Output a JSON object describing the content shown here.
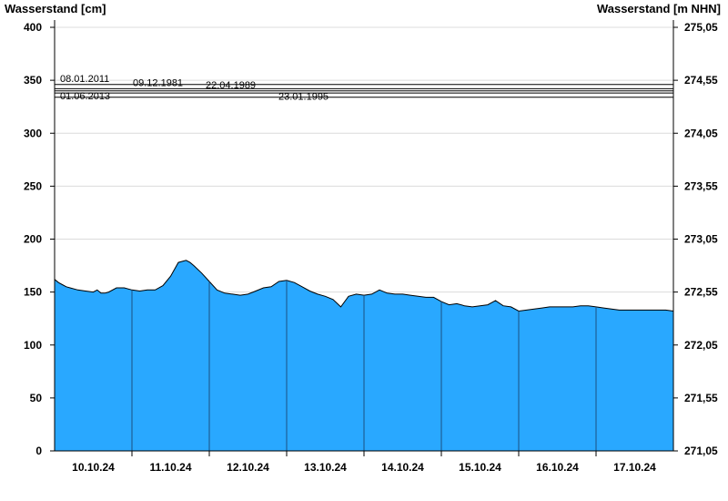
{
  "chart_data": {
    "type": "area",
    "ylabel_left": "Wasserstand [cm]",
    "ylabel_right": "Wasserstand [m NHN]",
    "ylim": [
      0,
      400
    ],
    "y_ticks_left": [
      "0",
      "50",
      "100",
      "150",
      "200",
      "250",
      "300",
      "350",
      "400"
    ],
    "y_ticks_right": [
      "271,05",
      "271,55",
      "272,05",
      "272,55",
      "273,05",
      "273,55",
      "274,05",
      "274,55",
      "275,05"
    ],
    "x_tick_labels": [
      "10.10.24",
      "11.10.24",
      "12.10.24",
      "13.10.24",
      "14.10.24",
      "15.10.24",
      "16.10.24",
      "17.10.24"
    ],
    "grid": true,
    "fill_color": "#29a8ff",
    "line_color": "#000000",
    "x_unit": "days since 09.10.24 12:00",
    "series": [
      {
        "x": [
          0.0,
          0.05,
          0.1,
          0.15,
          0.2,
          0.3,
          0.4,
          0.5,
          0.55,
          0.6,
          0.65,
          0.7,
          0.8,
          0.9,
          1.0,
          1.1,
          1.2,
          1.3,
          1.4,
          1.5,
          1.6,
          1.7,
          1.75,
          1.8,
          1.9,
          2.0,
          2.1,
          2.2,
          2.3,
          2.4,
          2.5,
          2.6,
          2.7,
          2.8,
          2.9,
          3.0,
          3.1,
          3.2,
          3.3,
          3.4,
          3.5,
          3.6,
          3.7,
          3.8,
          3.9,
          4.0,
          4.1,
          4.2,
          4.3,
          4.4,
          4.5,
          4.6,
          4.7,
          4.8,
          4.9,
          5.0,
          5.1,
          5.2,
          5.3,
          5.4,
          5.5,
          5.6,
          5.7,
          5.8,
          5.9,
          6.0,
          6.1,
          6.2,
          6.3,
          6.4,
          6.5,
          6.6,
          6.7,
          6.8,
          6.9,
          7.0,
          7.1,
          7.2,
          7.3,
          7.4,
          7.5,
          7.6,
          7.7,
          7.8,
          7.9,
          8.0
        ],
        "y": [
          162,
          159,
          157,
          155,
          154,
          152,
          151,
          150,
          152,
          149,
          149,
          150,
          154,
          154,
          152,
          151,
          152,
          152,
          156,
          165,
          178,
          180,
          178,
          175,
          168,
          160,
          152,
          149,
          148,
          147,
          148,
          151,
          154,
          155,
          160,
          161,
          159,
          155,
          151,
          148,
          146,
          143,
          136,
          146,
          148,
          147,
          148,
          152,
          149,
          148,
          148,
          147,
          146,
          145,
          145,
          141,
          138,
          139,
          137,
          136,
          137,
          138,
          142,
          137,
          136,
          132,
          133,
          134,
          135,
          136,
          136,
          136,
          136,
          137,
          137,
          136,
          135,
          134,
          133,
          133,
          133,
          133,
          133,
          133,
          133,
          132
        ]
      }
    ],
    "reference_lines": [
      {
        "label": "08.01.2011",
        "value": 346
      },
      {
        "label": "09.12.1981",
        "value": 342
      },
      {
        "label": "22.04.1989",
        "value": 340
      },
      {
        "label": "01.06.2013",
        "value": 338
      },
      {
        "label": "23.01.1995",
        "value": 334
      }
    ]
  }
}
